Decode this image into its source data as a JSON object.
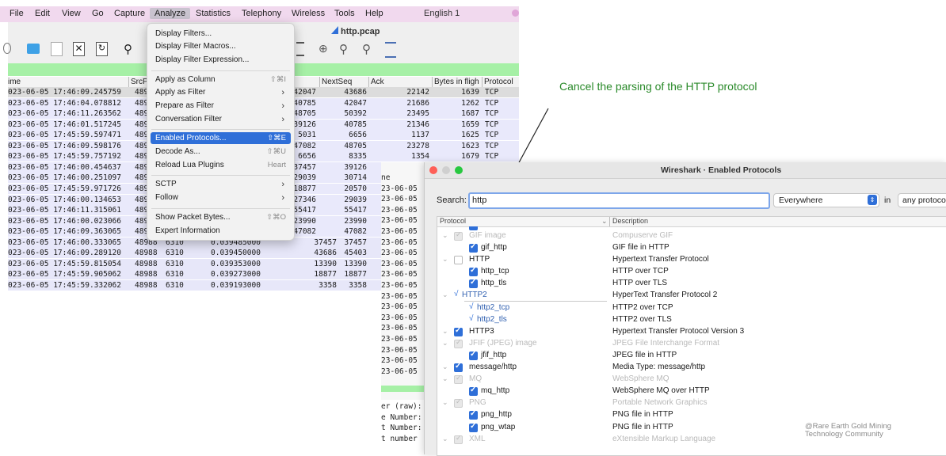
{
  "menubar": {
    "items": [
      "File",
      "Edit",
      "View",
      "Go",
      "Capture",
      "Analyze",
      "Statistics",
      "Telephony",
      "Wireless",
      "Tools",
      "Help"
    ],
    "language": "English 1"
  },
  "window_title": "http.pcap",
  "packet_list": {
    "columns": [
      "ime",
      "SrcP",
      "NextSeq",
      "Ack",
      "Bytes in fligh",
      "Protocol"
    ],
    "rows": [
      {
        "time": "023-06-05 17:46:09.245759",
        "src": "489",
        "seq": "42047",
        "nextseq": "43686",
        "ack": "22142",
        "bytes": "1639",
        "proto": "TCP"
      },
      {
        "time": "023-06-05 17:46:04.078812",
        "src": "489",
        "seq": "40785",
        "nextseq": "42047",
        "ack": "21686",
        "bytes": "1262",
        "proto": "TCP"
      },
      {
        "time": "023-06-05 17:46:11.263562",
        "src": "489",
        "seq": "48705",
        "nextseq": "50392",
        "ack": "23495",
        "bytes": "1687",
        "proto": "TCP"
      },
      {
        "time": "023-06-05 17:46:01.517245",
        "src": "489",
        "seq": "39126",
        "nextseq": "40785",
        "ack": "21346",
        "bytes": "1659",
        "proto": "TCP"
      },
      {
        "time": "023-06-05 17:45:59.597471",
        "src": "489",
        "seq": "5031",
        "nextseq": "6656",
        "ack": "1137",
        "bytes": "1625",
        "proto": "TCP"
      },
      {
        "time": "023-06-05 17:46:09.598176",
        "src": "489",
        "seq": "47082",
        "nextseq": "48705",
        "ack": "23278",
        "bytes": "1623",
        "proto": "TCP"
      },
      {
        "time": "023-06-05 17:45:59.757192",
        "src": "489",
        "seq": "6656",
        "nextseq": "8335",
        "ack": "1354",
        "bytes": "1679",
        "proto": "TCP"
      },
      {
        "time": "023-06-05 17:46:00.454637",
        "src": "489",
        "seq": "37457",
        "nextseq": "39126",
        "ack": "",
        "bytes": "",
        "proto": ""
      },
      {
        "time": "023-06-05 17:46:00.251097",
        "src": "489",
        "seq": "29039",
        "nextseq": "30714",
        "ack": "",
        "bytes": "",
        "proto": ""
      },
      {
        "time": "023-06-05 17:45:59.971726",
        "src": "489",
        "seq": "18877",
        "nextseq": "20570",
        "ack": "",
        "bytes": "",
        "proto": ""
      },
      {
        "time": "023-06-05 17:46:00.134653",
        "src": "489",
        "seq": "27346",
        "nextseq": "29039",
        "ack": "",
        "bytes": "",
        "proto": ""
      },
      {
        "time": "023-06-05 17:46:11.315061",
        "src": "489",
        "seq": "55417",
        "nextseq": "55417",
        "ack": "",
        "bytes": "",
        "proto": ""
      },
      {
        "time": "023-06-05 17:46:00.023066",
        "src": "489",
        "seq": "23990",
        "nextseq": "23990",
        "ack": "",
        "bytes": "",
        "proto": ""
      },
      {
        "time": "023-06-05 17:46:09.363065",
        "src": "489",
        "seq": "47082",
        "nextseq": "47082",
        "ack": "",
        "bytes": "",
        "proto": ""
      },
      {
        "time": "023-06-05 17:46:00.333065",
        "src": "48988",
        "port": "6310",
        "delta": "0.039485000",
        "seq": "37457",
        "nextseq": "37457"
      },
      {
        "time": "023-06-05 17:46:09.289120",
        "src": "48988",
        "port": "6310",
        "delta": "0.039450000",
        "seq": "43686",
        "nextseq": "45403"
      },
      {
        "time": "023-06-05 17:45:59.815054",
        "src": "48988",
        "port": "6310",
        "delta": "0.039353000",
        "seq": "13390",
        "nextseq": "13390"
      },
      {
        "time": "023-06-05 17:45:59.905062",
        "src": "48988",
        "port": "6310",
        "delta": "0.039273000",
        "seq": "18877",
        "nextseq": "18877"
      },
      {
        "time": "023-06-05 17:45:59.332062",
        "src": "48988",
        "port": "6310",
        "delta": "0.039193000",
        "seq": "3358",
        "nextseq": "3358"
      }
    ]
  },
  "analyze_menu": {
    "items": [
      {
        "label": "Display Filters...",
        "shortcut": "",
        "submenu": false
      },
      {
        "label": "Display Filter Macros...",
        "shortcut": "",
        "submenu": false
      },
      {
        "label": "Display Filter Expression...",
        "shortcut": "",
        "submenu": false
      },
      {
        "label": "Apply as Column",
        "shortcut": "⇧⌘I",
        "submenu": false
      },
      {
        "label": "Apply as Filter",
        "shortcut": "",
        "submenu": true
      },
      {
        "label": "Prepare as Filter",
        "shortcut": "",
        "submenu": true
      },
      {
        "label": "Conversation Filter",
        "shortcut": "",
        "submenu": true
      },
      {
        "label": "Enabled Protocols...",
        "shortcut": "⇧⌘E",
        "submenu": false
      },
      {
        "label": "Decode As...",
        "shortcut": "⇧⌘U",
        "submenu": false
      },
      {
        "label": "Reload Lua Plugins",
        "shortcut": "Heart",
        "submenu": false
      },
      {
        "label": "SCTP",
        "shortcut": "",
        "submenu": true
      },
      {
        "label": "Follow",
        "shortcut": "",
        "submenu": true
      },
      {
        "label": "Show Packet Bytes...",
        "shortcut": "⇧⌘O",
        "submenu": false
      },
      {
        "label": "Expert Information",
        "shortcut": "",
        "submenu": false
      }
    ]
  },
  "annotation": "Cancel the parsing of the HTTP protocol",
  "bg_window": {
    "lines_top": [
      "ne",
      "23-06-05",
      "23-06-05",
      "23-06-05",
      "23-06-05",
      "23-06-05",
      "23-06-05",
      "23-06-05",
      "23-06-05",
      "23-06-05",
      "23-06-05",
      "23-06-05",
      "23-06-05",
      "23-06-05",
      "23-06-05",
      "23-06-05",
      "23-06-05",
      "23-06-05",
      "23-06-05"
    ],
    "lines_bottom": [
      "er (raw):",
      "e Number:",
      "t Number:",
      "t number"
    ]
  },
  "enabled_protocols": {
    "title": "Wireshark · Enabled Protocols",
    "search_label": "Search:",
    "search_value": "http",
    "scope_value": "Everywhere",
    "in_label": "in",
    "in_value": "any protocol",
    "col_protocol": "Protocol",
    "col_description": "Description",
    "rows": [
      {
        "name": "gif_http",
        "desc": "GIF file in HTTP",
        "level": 1,
        "state": "on",
        "style": "normal"
      },
      {
        "name": "HTTP",
        "desc": "Hypertext Transfer Protocol",
        "level": 0,
        "state": "off",
        "style": "normal"
      },
      {
        "name": "http_tcp",
        "desc": "HTTP over TCP",
        "level": 1,
        "state": "on",
        "style": "normal"
      },
      {
        "name": "http_tls",
        "desc": "HTTP over TLS",
        "level": 1,
        "state": "on",
        "style": "normal"
      },
      {
        "name": "HTTP2",
        "desc": "HyperText Transfer Protocol 2",
        "level": 0,
        "state": "tick",
        "style": "blue"
      },
      {
        "name": "http2_tcp",
        "desc": "HTTP2 over TCP",
        "level": 1,
        "state": "tick",
        "style": "blue"
      },
      {
        "name": "http2_tls",
        "desc": "HTTP2 over TLS",
        "level": 1,
        "state": "tick",
        "style": "blue"
      },
      {
        "name": "HTTP3",
        "desc": "Hypertext Transfer Protocol Version 3",
        "level": 0,
        "state": "on",
        "style": "normal"
      },
      {
        "name": "JFIF (JPEG) image",
        "desc": "JPEG File Interchange Format",
        "level": 0,
        "state": "gray",
        "style": "dim"
      },
      {
        "name": "jfif_http",
        "desc": "JPEG file in HTTP",
        "level": 1,
        "state": "on",
        "style": "normal"
      },
      {
        "name": "message/http",
        "desc": "Media Type: message/http",
        "level": 0,
        "state": "on",
        "style": "normal"
      },
      {
        "name": "MQ",
        "desc": "WebSphere MQ",
        "level": 0,
        "state": "gray",
        "style": "dim"
      },
      {
        "name": "mq_http",
        "desc": "WebSphere MQ over HTTP",
        "level": 1,
        "state": "on",
        "style": "normal"
      },
      {
        "name": "PNG",
        "desc": "Portable Network Graphics",
        "level": 0,
        "state": "gray",
        "style": "dim"
      },
      {
        "name": "png_http",
        "desc": "PNG file in HTTP",
        "level": 1,
        "state": "on",
        "style": "normal"
      },
      {
        "name": "png_wtap",
        "desc": "PNG file in HTTP",
        "level": 1,
        "state": "on",
        "style": "normal"
      },
      {
        "name": "XML",
        "desc": "eXtensible Markup Language",
        "level": 0,
        "state": "gray",
        "style": "dim"
      }
    ],
    "partial_top": {
      "name": "GIF image",
      "desc": "Compuserve GIF"
    }
  },
  "watermark": [
    "@Rare Earth Gold Mining",
    "Technology Community"
  ]
}
